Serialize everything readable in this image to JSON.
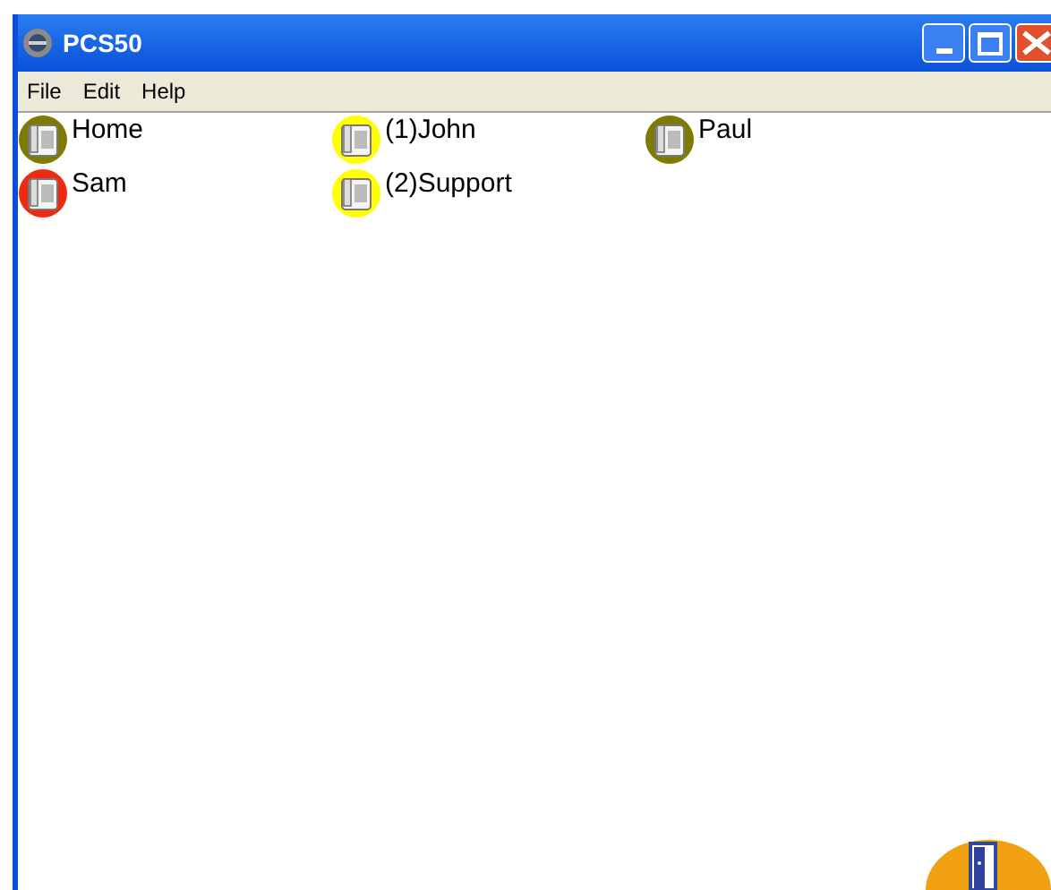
{
  "window": {
    "title": "PCS50"
  },
  "menu": [
    "File",
    "Edit",
    "Help"
  ],
  "contacts": [
    {
      "name": "Home",
      "color": "#7f7a00"
    },
    {
      "name": "(1)John",
      "color": "#ffff00"
    },
    {
      "name": "Paul",
      "color": "#7f7a00"
    },
    {
      "name": "Sam",
      "color": "#f02a10"
    },
    {
      "name": "(2)Support",
      "color": "#ffff00"
    }
  ]
}
